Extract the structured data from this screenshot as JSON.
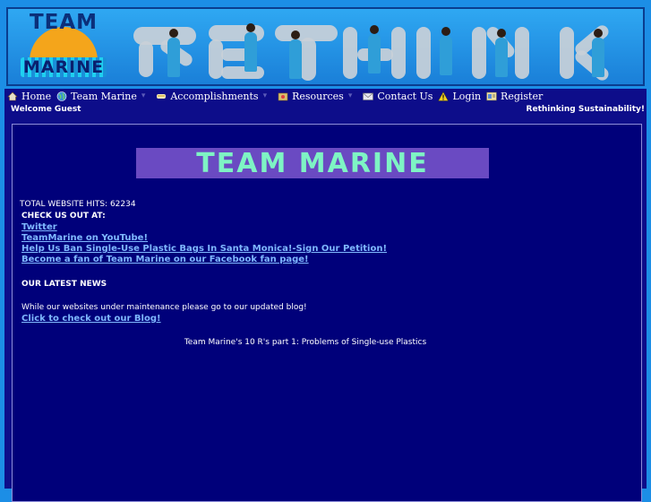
{
  "header": {
    "logo_top": "TEAM",
    "logo_bottom": "MARINE"
  },
  "nav": {
    "items": [
      {
        "label": "Home",
        "icon": "house-icon"
      },
      {
        "label": "Team Marine",
        "icon": "globe-icon"
      },
      {
        "label": "Accomplishments",
        "icon": "trophy-icon"
      },
      {
        "label": "Resources",
        "icon": "folder-icon"
      },
      {
        "label": "Contact Us",
        "icon": "envelope-icon"
      },
      {
        "label": "Login",
        "icon": "warning-icon"
      },
      {
        "label": "Register",
        "icon": "register-icon"
      }
    ]
  },
  "welcome": {
    "greeting": "Welcome Guest",
    "tagline": "Rethinking Sustainability!"
  },
  "main": {
    "banner_title": "TEAM MARINE",
    "hits": "TOTAL WEBSITE HITS: 62234",
    "checkout_heading": "CHECK US OUT AT:",
    "links": [
      "Twitter",
      "TeamMarine on YouTube!",
      "Help Us Ban Single-Use Plastic Bags In Santa Monica!-Sign Our Petition!",
      "Become a fan of Team Marine on our Facebook fan page!"
    ],
    "news_heading": "OUR LATEST NEWS",
    "maintenance_text": "While our websites under maintenance please go to our updated blog!",
    "blog_link": "Click to check out our Blog!",
    "post_title": "Team Marine's 10 R's part 1: Problems of Single-use Plastics"
  },
  "colors": {
    "page_bg": "#1c8ee6",
    "panel_bg": "#0d0d8a",
    "link": "#7fb8ff",
    "banner_text": "#7ef4c4",
    "banner_bg": "#6a4ac2"
  }
}
